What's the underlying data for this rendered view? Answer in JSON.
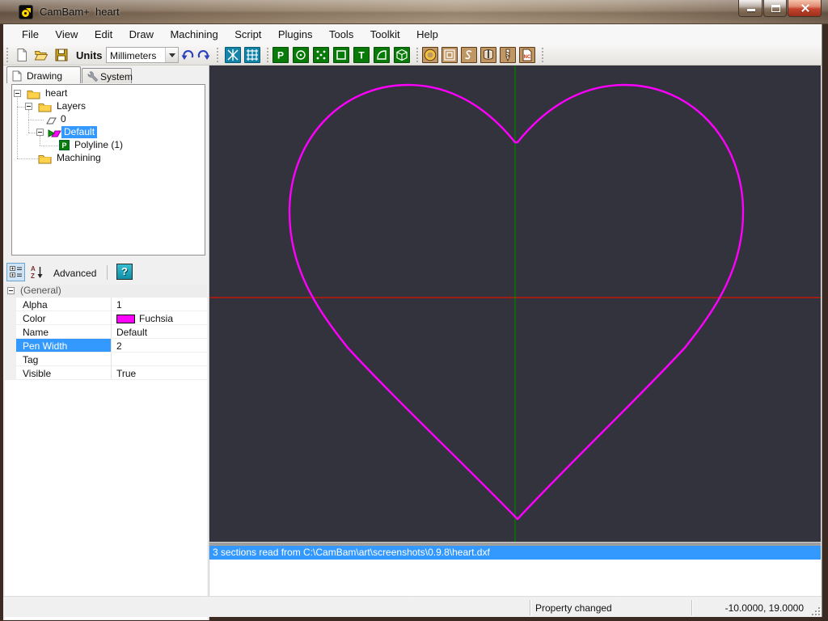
{
  "window": {
    "title": "CamBam+  heart"
  },
  "menu": {
    "items": [
      "File",
      "View",
      "Edit",
      "Draw",
      "Machining",
      "Script",
      "Plugins",
      "Tools",
      "Toolkit",
      "Help"
    ]
  },
  "toolbar": {
    "units_label": "Units",
    "units_value": "Millimeters",
    "icons": [
      "new-file",
      "open-file",
      "save-file",
      "undo",
      "redo",
      "snap-to-points",
      "snap-to-grid",
      "draw-polyline",
      "draw-circle",
      "draw-points",
      "draw-rectangle",
      "draw-text",
      "draw-surface",
      "draw-3d-object",
      "mop-profile",
      "mop-pocket",
      "mop-engrave",
      "mop-3d-profile",
      "mop-drill",
      "gcode-output"
    ]
  },
  "sidebar": {
    "tabs": [
      {
        "label": "Drawing"
      },
      {
        "label": "System"
      }
    ],
    "tree": {
      "heart": "heart",
      "layers": "Layers",
      "layer0": "0",
      "default_layer": "Default",
      "polyline": "Polyline (1)",
      "machining": "Machining"
    },
    "properties": {
      "toolbar": {
        "advanced_label": "Advanced",
        "help_label": "?"
      },
      "category": "(General)",
      "rows": [
        {
          "name": "Alpha",
          "value": "1"
        },
        {
          "name": "Color",
          "value": "Fuchsia",
          "swatch": "#FF00FF"
        },
        {
          "name": "Name",
          "value": "Default"
        },
        {
          "name": "Pen Width",
          "value": "2"
        },
        {
          "name": "Tag",
          "value": ""
        },
        {
          "name": "Visible",
          "value": "True"
        }
      ]
    }
  },
  "canvas": {
    "background": "#32333D",
    "axis_vertical_color": "#008000",
    "axis_horizontal_color": "#DD1100",
    "heart_color": "#FF00FF",
    "heart_pen_width": "2.4"
  },
  "log": {
    "highlight": "#3399FF",
    "message": "3 sections read from C:\\CamBam\\art\\screenshots\\0.9.8\\heart.dxf"
  },
  "statusbar": {
    "message": "Property changed",
    "coordinates": "-10.0000, 19.0000"
  }
}
